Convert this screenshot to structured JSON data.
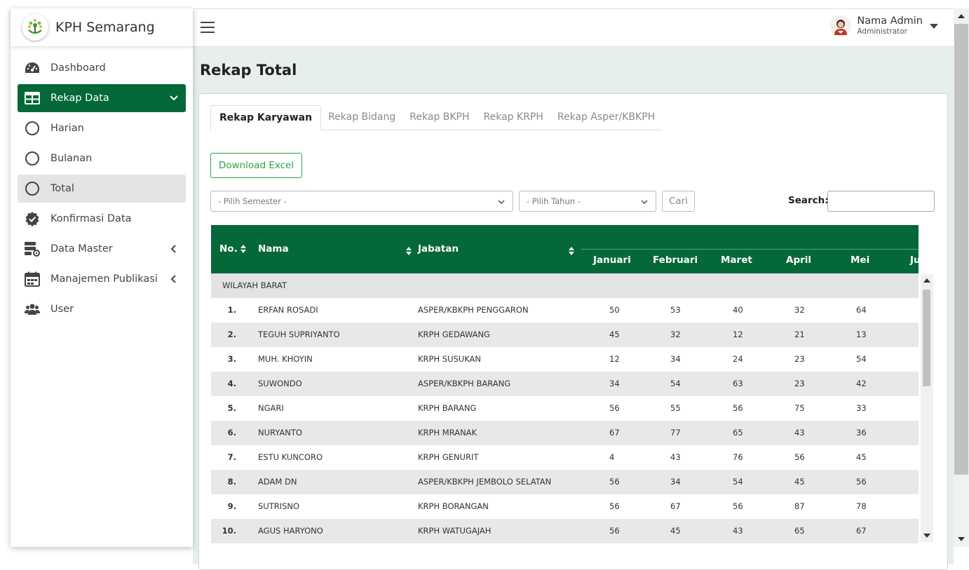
{
  "brand": {
    "title": "KPH Semarang"
  },
  "sidebar": {
    "items": [
      {
        "label": "Dashboard"
      },
      {
        "label": "Rekap Data"
      },
      {
        "label": "Harian"
      },
      {
        "label": "Bulanan"
      },
      {
        "label": "Total"
      },
      {
        "label": "Konfirmasi Data"
      },
      {
        "label": "Data Master"
      },
      {
        "label": "Manajemen Publikasi"
      },
      {
        "label": "User"
      }
    ]
  },
  "user": {
    "name": "Nama Admin",
    "role": "Administrator"
  },
  "page": {
    "title": "Rekap Total"
  },
  "tabs": [
    {
      "label": "Rekap Karyawan"
    },
    {
      "label": "Rekap Bidang"
    },
    {
      "label": "Rekap BKPH"
    },
    {
      "label": "Rekap KRPH"
    },
    {
      "label": "Rekap Asper/KBKPH"
    }
  ],
  "toolbar": {
    "download_label": "Download Excel",
    "semester_placeholder": "- Pilih Semester -",
    "tahun_placeholder": "- Pilih Tahun -",
    "cari_label": "Cari",
    "search_label": "Search:"
  },
  "table": {
    "headers": {
      "no": "No.",
      "nama": "Nama",
      "jabatan": "Jabatan"
    },
    "months": [
      "Januari",
      "Februari",
      "Maret",
      "April",
      "Mei",
      "Ju"
    ],
    "group": "WILAYAH BARAT",
    "rows": [
      {
        "no": "1.",
        "nama": "ERFAN ROSADI",
        "jabatan": "ASPER/KBKPH PENGGARON",
        "jan": "50",
        "feb": "53",
        "mar": "40",
        "apr": "32",
        "mei": "64"
      },
      {
        "no": "2.",
        "nama": "TEGUH SUPRIYANTO",
        "jabatan": "KRPH GEDAWANG",
        "jan": "45",
        "feb": "32",
        "mar": "12",
        "apr": "21",
        "mei": "13"
      },
      {
        "no": "3.",
        "nama": "MUH. KHOYIN",
        "jabatan": "KRPH SUSUKAN",
        "jan": "12",
        "feb": "34",
        "mar": "24",
        "apr": "23",
        "mei": "54"
      },
      {
        "no": "4.",
        "nama": "SUWONDO",
        "jabatan": "ASPER/KBKPH BARANG",
        "jan": "34",
        "feb": "54",
        "mar": "63",
        "apr": "23",
        "mei": "42"
      },
      {
        "no": "5.",
        "nama": "NGARI",
        "jabatan": "KRPH BARANG",
        "jan": "56",
        "feb": "55",
        "mar": "56",
        "apr": "75",
        "mei": "33"
      },
      {
        "no": "6.",
        "nama": "NURYANTO",
        "jabatan": "KRPH MRANAK",
        "jan": "67",
        "feb": "77",
        "mar": "65",
        "apr": "43",
        "mei": "36"
      },
      {
        "no": "7.",
        "nama": "ESTU KUNCORO",
        "jabatan": "KRPH GENURIT",
        "jan": "4",
        "feb": "43",
        "mar": "76",
        "apr": "56",
        "mei": "45"
      },
      {
        "no": "8.",
        "nama": "ADAM DN",
        "jabatan": "ASPER/KBKPH JEMBOLO SELATAN",
        "jan": "56",
        "feb": "34",
        "mar": "54",
        "apr": "45",
        "mei": "56"
      },
      {
        "no": "9.",
        "nama": "SUTRISNO",
        "jabatan": "KRPH BORANGAN",
        "jan": "56",
        "feb": "67",
        "mar": "56",
        "apr": "87",
        "mei": "78"
      },
      {
        "no": "10.",
        "nama": "AGUS HARYONO",
        "jabatan": "KRPH WATUGAJAH",
        "jan": "56",
        "feb": "45",
        "mar": "43",
        "apr": "65",
        "mei": "67"
      }
    ]
  },
  "colors": {
    "primary": "#056839",
    "content_bg": "#e7efec",
    "excel_button": "#28a745"
  }
}
